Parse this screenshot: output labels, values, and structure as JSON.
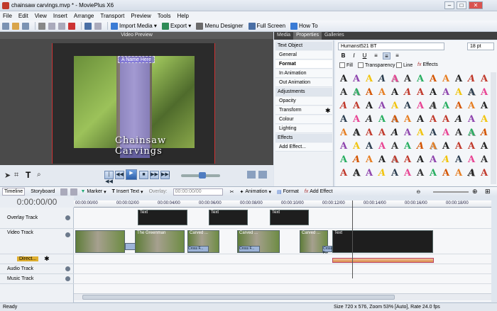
{
  "window": {
    "title": "chainsaw carvings.mvp * - MoviePlus X6",
    "min": "–",
    "max": "□",
    "close": "✕"
  },
  "menu": [
    "File",
    "Edit",
    "View",
    "Insert",
    "Arrange",
    "Transport",
    "Preview",
    "Tools",
    "Help"
  ],
  "toolbar": {
    "import_media": "Import Media",
    "export": "Export",
    "menu_designer": "Menu Designer",
    "full_screen": "Full Screen",
    "how_to": "How To"
  },
  "preview": {
    "header": "Video Preview",
    "overlay_text": "A Name Here",
    "caption": "Chainsaw Carvings"
  },
  "transport_icons": [
    "|◀◀",
    "◀◀",
    "▶",
    "■",
    "▶▶",
    "▶▶|"
  ],
  "right_tabs": [
    "Media",
    "Properties",
    "Galleries"
  ],
  "properties": {
    "groups": [
      {
        "label": "Text Object",
        "group": true
      },
      {
        "label": "General"
      },
      {
        "label": "Format",
        "selected": true
      },
      {
        "label": "In Animation"
      },
      {
        "label": "Out Animation"
      },
      {
        "label": "Adjustments",
        "group": true
      },
      {
        "label": "Opacity"
      },
      {
        "label": "Transform"
      },
      {
        "label": "Colour"
      },
      {
        "label": "Lighting"
      },
      {
        "label": "Effects",
        "group": true
      },
      {
        "label": "Add Effect..."
      }
    ]
  },
  "font": {
    "name": "Humanst521 BT",
    "size": "18 pt",
    "fill": "Fill",
    "transparency": "Transparency",
    "line": "Line",
    "effects": "Effects"
  },
  "style_colors": [
    "#222",
    "#333",
    "#c0392b",
    "#2c3e50",
    "#e67e22",
    "#8e44ad",
    "#27ae60",
    "#c0392b",
    "#e84393",
    "#222",
    "#f1c40f",
    "#d35400"
  ],
  "timeline": {
    "tabs": [
      "Timeline",
      "Storyboard"
    ],
    "marker": "Marker",
    "insert_text": "Insert Text",
    "overlay_label": "Overlay:",
    "overlay_value": "00:00:00/00",
    "animation": "Animation",
    "format": "Format",
    "add_effect": "Add Effect",
    "timecode": "0:00:00/00",
    "ruler": [
      "00:00:00/00",
      "00:00:02/00",
      "00:00:04/00",
      "00:00:06/00",
      "00:00:08/00",
      "00:00:10/00",
      "00:00:12/00",
      "00:00:14/00",
      "00:00:16/00",
      "00:00:18/00"
    ],
    "tracks": [
      "Overlay Track",
      "Video Track",
      "Direct...",
      "Audio Track",
      "Music Track"
    ],
    "clip_text": "Text",
    "video_labels": [
      "The Greenman",
      "Carved ...",
      "Carved ...",
      "Carved ..."
    ],
    "cross_labels": [
      "Cross F...",
      "Cross F...",
      "Cross F..."
    ]
  },
  "status": {
    "ready": "Ready",
    "info": "Size 720 x 576, Zoom 53% [Auto], Rate 24.0 fps"
  }
}
